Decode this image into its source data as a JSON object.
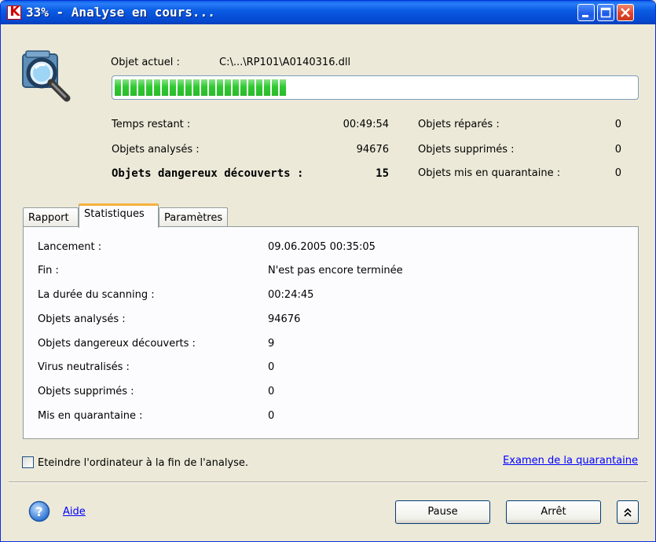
{
  "window": {
    "title": "33% - Analyse en cours..."
  },
  "scan": {
    "current_object_label": "Objet actuel :",
    "current_object_path": "C:\\...\\RP101\\A0140316.dll",
    "progress_fraction": 0.33,
    "stats": [
      {
        "label": "Temps restant :",
        "value": "00:49:54"
      },
      {
        "label": "Objets analysés :",
        "value": "94676"
      },
      {
        "label": "Objets dangereux découverts :",
        "value": "15"
      }
    ],
    "stats_right": [
      {
        "label": "Objets réparés :",
        "value": "0"
      },
      {
        "label": "Objets supprimés :",
        "value": "0"
      },
      {
        "label": "Objets mis en quarantaine :",
        "value": "0"
      }
    ]
  },
  "tabs": [
    {
      "label": "Rapport"
    },
    {
      "label": "Statistiques",
      "active": true
    },
    {
      "label": "Paramètres"
    }
  ],
  "statistics": [
    {
      "label": "Lancement :",
      "value": "09.06.2005 00:35:05"
    },
    {
      "label": "Fin :",
      "value": "N'est pas encore terminée"
    },
    {
      "label": "La durée du scanning :",
      "value": "00:24:45"
    },
    {
      "label": "Objets analysés :",
      "value": "94676"
    },
    {
      "label": "Objets dangereux découverts :",
      "value": "9"
    },
    {
      "label": "Virus neutralisés :",
      "value": "0"
    },
    {
      "label": "Objets supprimés :",
      "value": "0"
    },
    {
      "label": "Mis en quarantaine :",
      "value": "0"
    }
  ],
  "options": {
    "shutdown_label": "Eteindre l'ordinateur à la fin de l'analyse.",
    "shutdown_checked": false,
    "quarantine_link": "Examen de la quarantaine"
  },
  "footer": {
    "help_label": "Aide",
    "pause_label": "Pause",
    "stop_label": "Arrêt",
    "expand_glyph": "»"
  },
  "colors": {
    "titlebar": "#0548d0",
    "progress": "#2fca2f",
    "active_tab_accent": "#f4b13b",
    "link": "#0000ff"
  },
  "icons": {
    "app": "kaspersky-k-icon",
    "scan": "magnifier-scan-icon",
    "help": "help-icon"
  }
}
